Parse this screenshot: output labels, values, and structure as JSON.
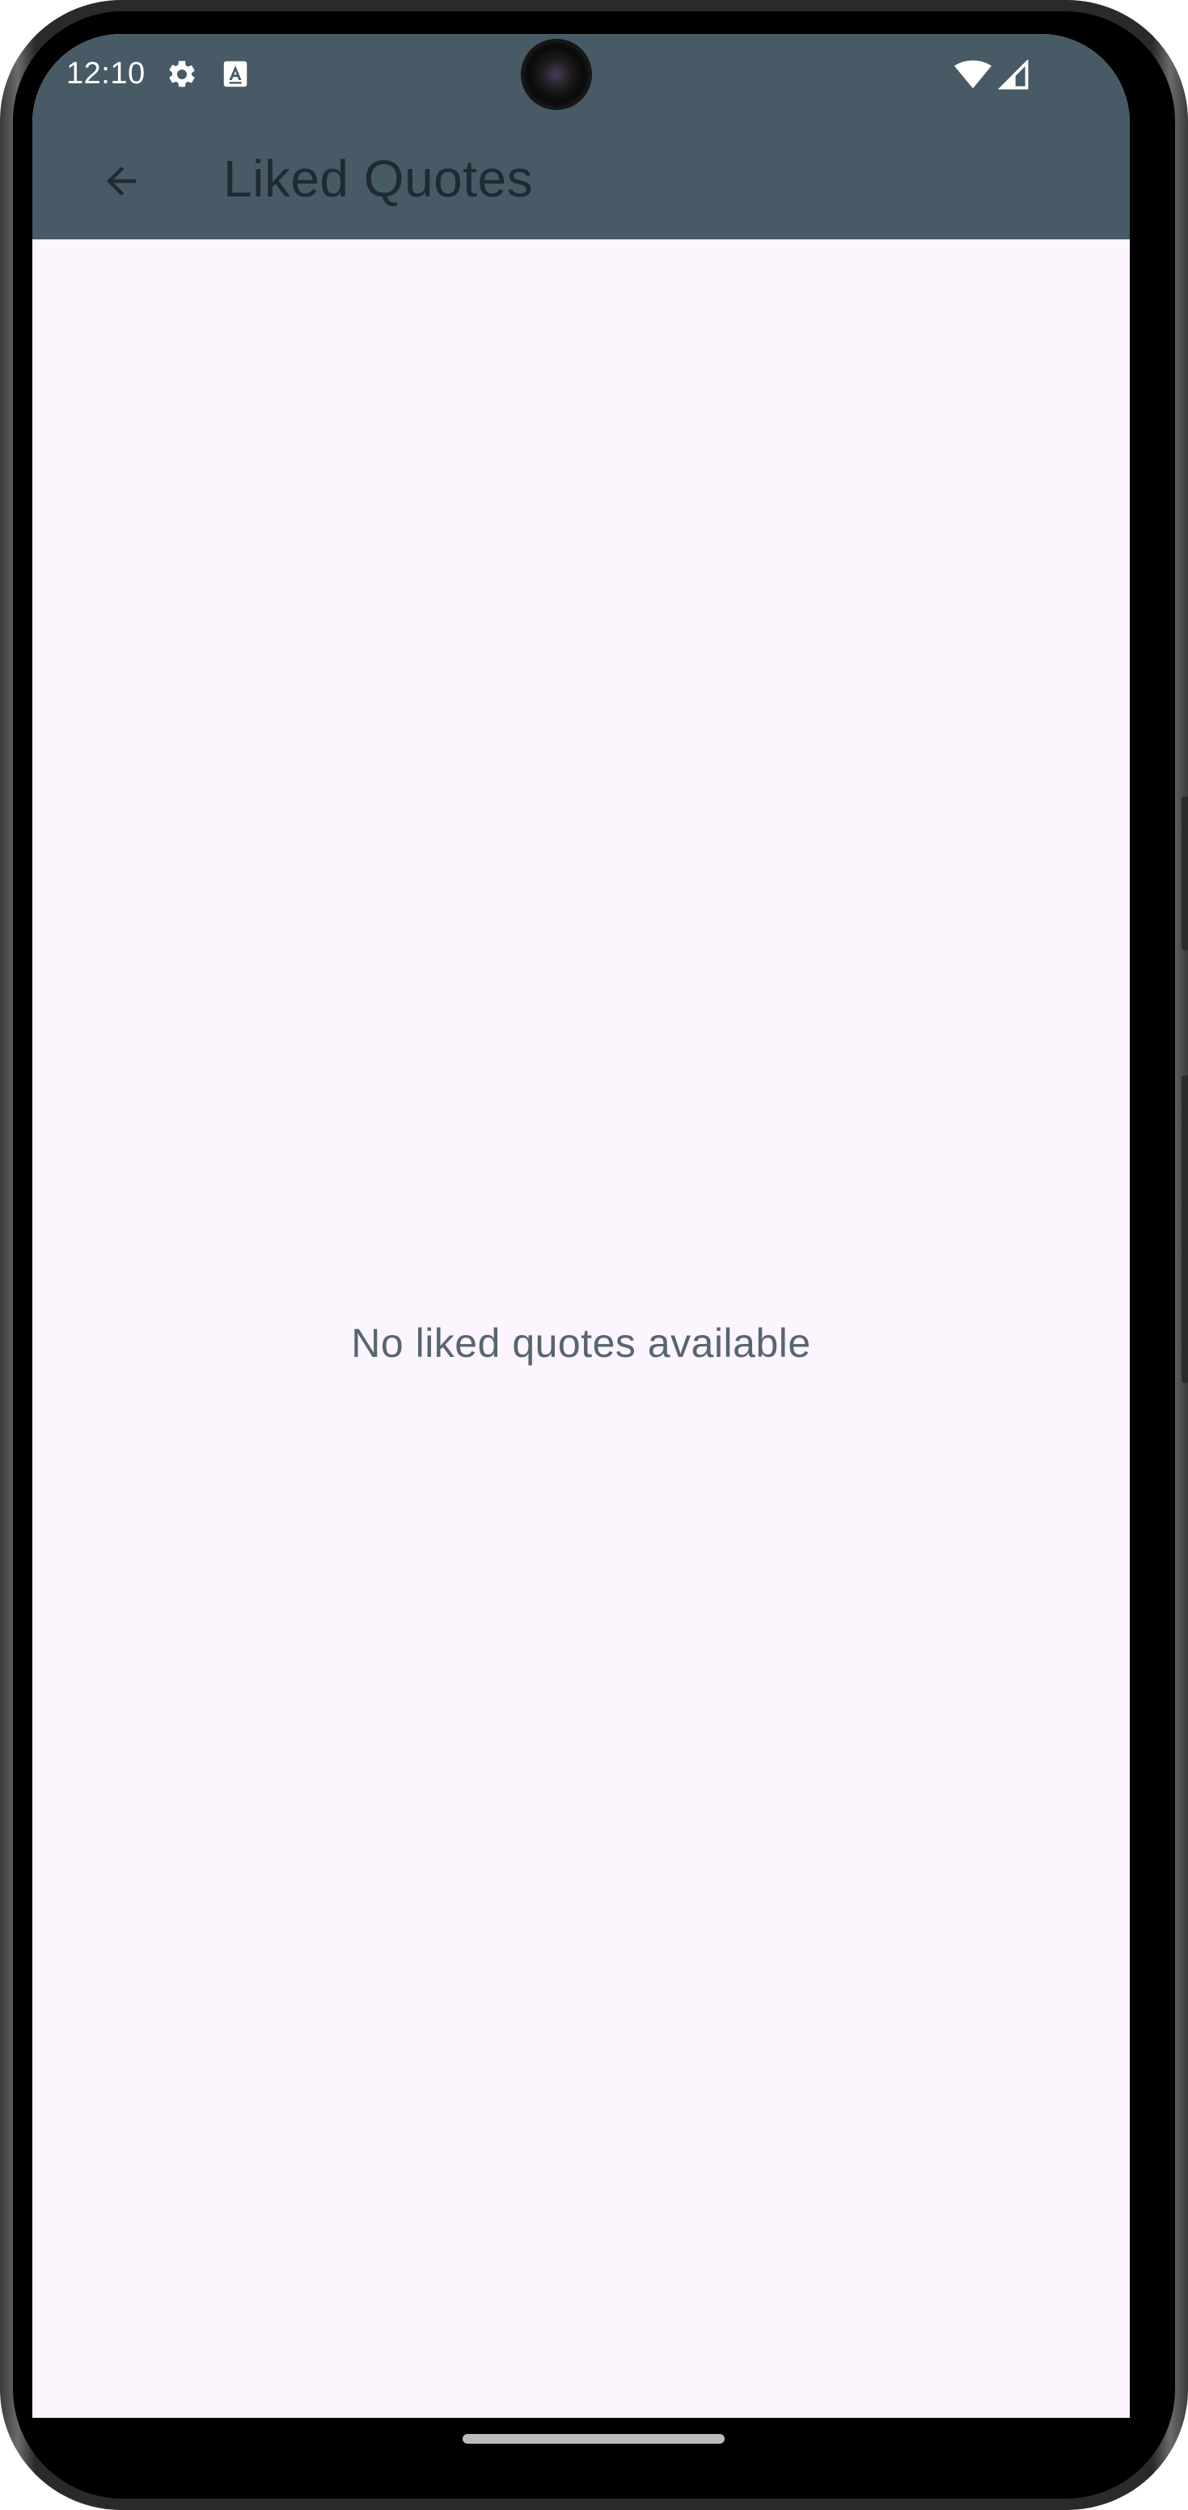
{
  "status_bar": {
    "time": "12:10",
    "icons": [
      "gear-icon",
      "accessibility-font-icon",
      "wifi-icon",
      "cellular-signal-icon"
    ]
  },
  "app_bar": {
    "title": "Liked Quotes",
    "back_icon": "arrow-back-icon",
    "background_color": "#475a66"
  },
  "content": {
    "empty_message": "No liked quotes available",
    "background_color": "#fcf5fd"
  }
}
